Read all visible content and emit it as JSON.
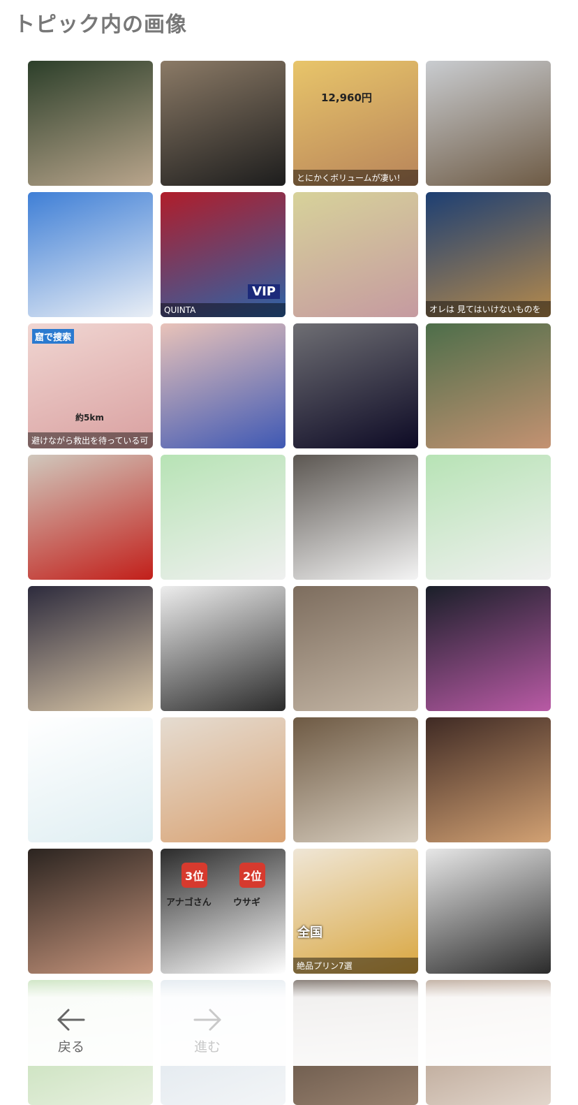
{
  "page": {
    "title": "トピック内の画像"
  },
  "thumbnails": [
    {
      "name": "thumb-waterfall",
      "colors": [
        "#2c3f2a",
        "#b9a58c"
      ],
      "overlay": ""
    },
    {
      "name": "thumb-massage-chair",
      "colors": [
        "#8b7a66",
        "#1d1d1d"
      ],
      "overlay": ""
    },
    {
      "name": "thumb-sausage-ad",
      "colors": [
        "#e8c56a",
        "#b8845a"
      ],
      "overlay": "とにかくボリュームが凄い!"
    },
    {
      "name": "thumb-figurine",
      "colors": [
        "#c9ccd0",
        "#6e5b45"
      ],
      "overlay": ""
    },
    {
      "name": "thumb-cloud-sky",
      "colors": [
        "#3f7fd6",
        "#e9eef5"
      ],
      "overlay": ""
    },
    {
      "name": "thumb-quinta-poster",
      "colors": [
        "#b01d2a",
        "#2d64a8"
      ],
      "overlay": "QUINTA"
    },
    {
      "name": "thumb-soap-dish",
      "colors": [
        "#d7d29a",
        "#c59aa0"
      ],
      "overlay": ""
    },
    {
      "name": "thumb-game-warrior",
      "colors": [
        "#1d3f73",
        "#b58a4c"
      ],
      "overlay": "オレは 見てはいけないものを"
    },
    {
      "name": "thumb-cave-map",
      "colors": [
        "#f0d6d2",
        "#d9a0a0"
      ],
      "overlay": "避けながら救出を待っている可"
    },
    {
      "name": "thumb-fan-tree",
      "colors": [
        "#e9c3b9",
        "#3e58b4"
      ],
      "overlay": ""
    },
    {
      "name": "thumb-cosmic-collage",
      "colors": [
        "#6e6e73",
        "#0d0a25"
      ],
      "overlay": ""
    },
    {
      "name": "thumb-lake-girls",
      "colors": [
        "#4d6e4a",
        "#c49272"
      ],
      "overlay": ""
    },
    {
      "name": "thumb-red-peppers",
      "colors": [
        "#d0c8bd",
        "#c21f1a"
      ],
      "overlay": ""
    },
    {
      "name": "thumb-guitar-singers-1",
      "colors": [
        "#b7e3b5",
        "#f0f0f0"
      ],
      "overlay": ""
    },
    {
      "name": "thumb-festival-crowd",
      "colors": [
        "#5c5752",
        "#f4f4f4"
      ],
      "overlay": ""
    },
    {
      "name": "thumb-guitar-singers-2",
      "colors": [
        "#b7e3b5",
        "#f0f0f0"
      ],
      "overlay": ""
    },
    {
      "name": "thumb-sushi-bar",
      "colors": [
        "#2d2b3d",
        "#d8c5a6"
      ],
      "overlay": ""
    },
    {
      "name": "thumb-dark-sculpture",
      "colors": [
        "#ededed",
        "#2a2a2a"
      ],
      "overlay": ""
    },
    {
      "name": "thumb-ceiling-room",
      "colors": [
        "#7d6d5e",
        "#c6b8a7"
      ],
      "overlay": ""
    },
    {
      "name": "thumb-fireworks",
      "colors": [
        "#1a1f29",
        "#b95aa5"
      ],
      "overlay": ""
    },
    {
      "name": "thumb-app-screenshot",
      "colors": [
        "#ffffff",
        "#dfeef2"
      ],
      "overlay": ""
    },
    {
      "name": "thumb-peach-magazine",
      "colors": [
        "#e5dcd1",
        "#d9a374"
      ],
      "overlay": ""
    },
    {
      "name": "thumb-dog-window",
      "colors": [
        "#6e5a44",
        "#d9cfc0"
      ],
      "overlay": ""
    },
    {
      "name": "thumb-dog-blanket",
      "colors": [
        "#3f2a24",
        "#d2a173"
      ],
      "overlay": ""
    },
    {
      "name": "thumb-party-group",
      "colors": [
        "#2b2420",
        "#c7957c"
      ],
      "overlay": ""
    },
    {
      "name": "thumb-ranking-card",
      "colors": [
        "#2b2b2b",
        "#ffffff"
      ],
      "overlay": ""
    },
    {
      "name": "thumb-pudding-plate",
      "colors": [
        "#efe6d6",
        "#d9a63f"
      ],
      "overlay": "絶品プリン7選"
    },
    {
      "name": "thumb-three-people",
      "colors": [
        "#e7e7e7",
        "#2b2b2b"
      ],
      "overlay": ""
    },
    {
      "name": "thumb-partial-1",
      "colors": [
        "#b7d9a8",
        "#e8f0e0"
      ],
      "overlay": ""
    },
    {
      "name": "thumb-partial-2",
      "colors": [
        "#d8e2ea",
        "#f3f5f7"
      ],
      "overlay": ""
    },
    {
      "name": "thumb-partial-3",
      "colors": [
        "#4a3c32",
        "#9a8370"
      ],
      "overlay": ""
    },
    {
      "name": "thumb-partial-4",
      "colors": [
        "#a48a76",
        "#e2d6cc"
      ],
      "overlay": ""
    }
  ],
  "sausage_labels": {
    "price": "12,960円"
  },
  "quinta_labels": {
    "badge": "VIP"
  },
  "cave_labels": {
    "top": "窟で捜索",
    "distance": "約5km"
  },
  "ranking_labels": {
    "rank3": "3位",
    "rank2": "2位",
    "left": "アナゴさん",
    "right": "ウサギ"
  },
  "pudding_labels": {
    "top": "全国"
  },
  "nav": {
    "back_label": "戻る",
    "forward_label": "進む",
    "back_icon": "arrow-left-icon",
    "forward_icon": "arrow-right-icon"
  }
}
